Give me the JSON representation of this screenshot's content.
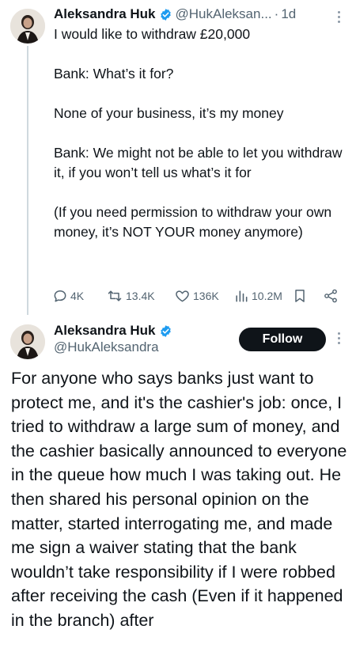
{
  "tweet1": {
    "author": {
      "display_name": "Aleksandra Huk",
      "handle": "@HukAleksan...",
      "time": "1d"
    },
    "text": {
      "line1": "I would like to withdraw £20,000",
      "line2": "Bank: What’s it for?",
      "line3": "None of your business, it’s my money",
      "line4": "Bank: We might not be able to let you withdraw it, if you won’t tell us what’s it for",
      "line5": "(If you need permission to withdraw your own money, it’s NOT YOUR money anymore)"
    },
    "actions": {
      "replies": "4K",
      "reposts": "13.4K",
      "likes": "136K",
      "views": "10.2M"
    }
  },
  "tweet2": {
    "author": {
      "display_name": "Aleksandra Huk",
      "handle": "@HukAleksandra"
    },
    "follow_label": "Follow",
    "text": "For anyone who says banks just want to protect me, and it's the cashier's job: once, I tried to withdraw a large sum of money, and the cashier basically announced to everyone in the queue how much I was taking out. He then shared his personal opinion on the matter, started interrogating me, and made me sign a waiver stating that the bank wouldn’t take responsibility if I were robbed after receiving the cash (Even if it happened in the branch) after"
  },
  "colors": {
    "verified_blue": "#1d9bf0",
    "text_primary": "#0f1419",
    "text_secondary": "#536471",
    "follow_bg": "#0f1419"
  },
  "icons": [
    "verified-badge-icon",
    "more-icon",
    "reply-icon",
    "repost-icon",
    "like-icon",
    "views-icon",
    "bookmark-icon",
    "share-icon"
  ]
}
